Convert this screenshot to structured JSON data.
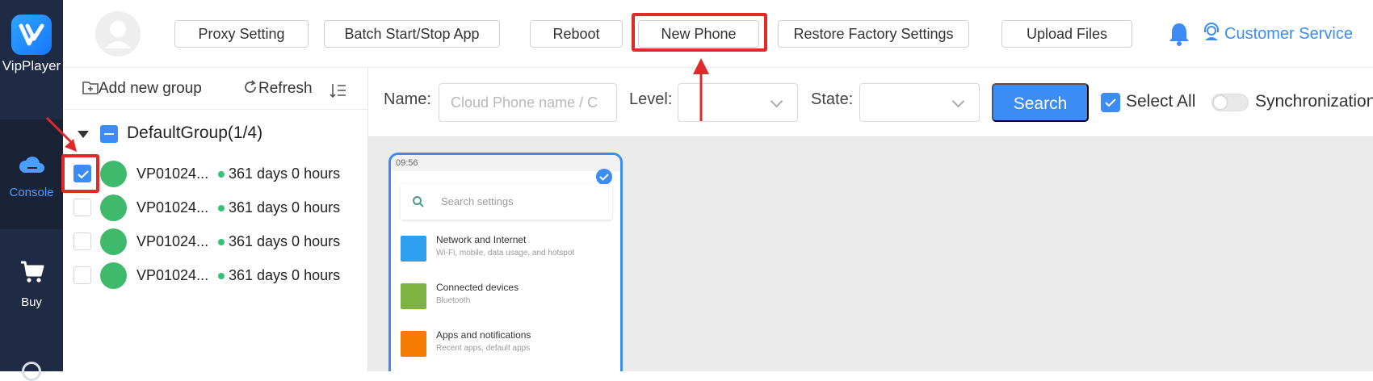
{
  "brand": {
    "name": "VipPlayer"
  },
  "nav": {
    "items": [
      {
        "label": "Console",
        "icon": "cloud-icon",
        "active": true
      },
      {
        "label": "Buy",
        "icon": "cart-icon",
        "active": false
      }
    ]
  },
  "toolbar": {
    "buttons": [
      {
        "label": "Proxy Setting"
      },
      {
        "label": "Batch Start/Stop App"
      },
      {
        "label": "Reboot"
      },
      {
        "label": "New Phone",
        "highlighted": true
      },
      {
        "label": "Restore Factory Settings"
      },
      {
        "label": "Upload Files"
      }
    ],
    "customer_service": "Customer Service"
  },
  "sidebar": {
    "add_group": "Add new group",
    "refresh": "Refresh",
    "group": {
      "label": "DefaultGroup(1/4)"
    },
    "devices": [
      {
        "name": "VP01024...",
        "time": "361 days 0 hours",
        "checked": true
      },
      {
        "name": "VP01024...",
        "time": "361 days 0 hours",
        "checked": false
      },
      {
        "name": "VP01024...",
        "time": "361 days 0 hours",
        "checked": false
      },
      {
        "name": "VP01024...",
        "time": "361 days 0 hours",
        "checked": false
      }
    ]
  },
  "filters": {
    "name_label": "Name:",
    "name_placeholder": "Cloud Phone name / C",
    "level_label": "Level:",
    "state_label": "State:",
    "search_button": "Search",
    "select_all": "Select All",
    "sync_label": "Synchronization"
  },
  "phone": {
    "status_time": "09:56",
    "search_placeholder": "Search settings",
    "settings": [
      {
        "title": "Network and Internet",
        "subtitle": "Wi-Fi, mobile, data usage, and hotspot",
        "color": "#2f9ff0"
      },
      {
        "title": "Connected devices",
        "subtitle": "Bluetooth",
        "color": "#7cb342"
      },
      {
        "title": "Apps and notifications",
        "subtitle": "Recent apps, default apps",
        "color": "#f57c00"
      }
    ]
  },
  "colors": {
    "accent": "#3b8cf5",
    "nav_bg": "#1f2a44",
    "annotation": "#e02a2a"
  }
}
